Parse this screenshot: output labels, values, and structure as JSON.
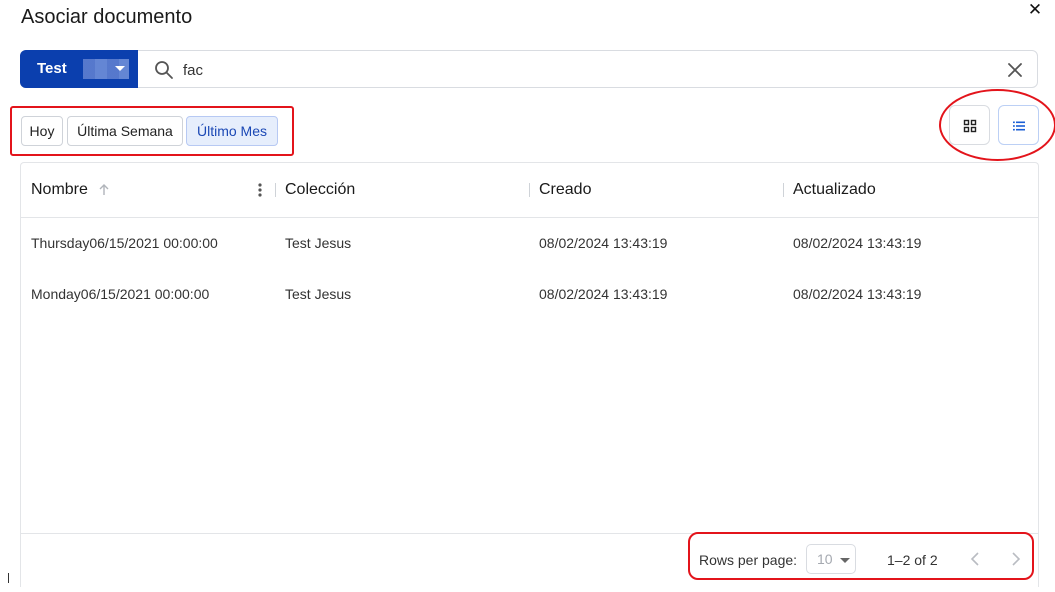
{
  "dialog": {
    "title": "Asociar documento"
  },
  "search": {
    "collection_label": "Test",
    "value": "fac",
    "placeholder": ""
  },
  "filters": [
    {
      "label": "Hoy",
      "active": false
    },
    {
      "label": "Última Semana",
      "active": false
    },
    {
      "label": "Último Mes",
      "active": true
    }
  ],
  "views": {
    "grid_icon": "grid-icon",
    "list_icon": "list-icon",
    "active": "list"
  },
  "table": {
    "columns": [
      "Nombre",
      "Colección",
      "Creado",
      "Actualizado"
    ],
    "rows": [
      [
        "Thursday06/15/2021 00:00:00",
        "Test Jesus",
        "08/02/2024 13:43:19",
        "08/02/2024 13:43:19"
      ],
      [
        "Monday06/15/2021 00:00:00",
        "Test Jesus",
        "08/02/2024 13:43:19",
        "08/02/2024 13:43:19"
      ]
    ]
  },
  "pagination": {
    "rows_per_page_label": "Rows per page:",
    "rows_per_page_value": "10",
    "range": "1–2 of 2"
  },
  "colors": {
    "primary": "#0b3fae",
    "annotation": "#e3141b",
    "chip_active_bg": "#e6eefc"
  }
}
